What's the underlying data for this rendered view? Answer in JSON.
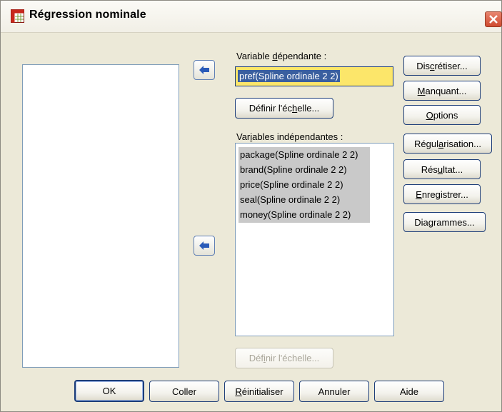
{
  "window": {
    "title": "Régression nominale"
  },
  "dependent": {
    "label_pre": "Variable ",
    "label_accel": "d",
    "label_post": "épendante :",
    "value": "pref(Spline ordinale 2 2)",
    "define_scale": {
      "pre": "Définir l'éc",
      "accel": "h",
      "post": "elle..."
    }
  },
  "independent": {
    "label_pre": "Var",
    "label_accel": "i",
    "label_post": "ables indépendantes :",
    "items": [
      "package(Spline ordinale 2 2)",
      "brand(Spline ordinale 2 2)",
      "price(Spline ordinale 2 2)",
      "seal(Spline ordinale 2 2)",
      "money(Spline ordinale 2 2)"
    ],
    "define_scale": {
      "pre": "Déf",
      "accel": "i",
      "post": "nir l'échelle..."
    }
  },
  "side_buttons": {
    "discretiser": {
      "pre": "Dis",
      "accel": "c",
      "post": "rétiser..."
    },
    "manquant": {
      "pre": "",
      "accel": "M",
      "post": "anquant..."
    },
    "options": {
      "pre": "",
      "accel": "O",
      "post": "ptions"
    },
    "regularisation": {
      "pre": "Régul",
      "accel": "a",
      "post": "risation..."
    },
    "resultat": {
      "pre": "Rés",
      "accel": "u",
      "post": "ltat..."
    },
    "enregistrer": {
      "pre": "",
      "accel": "E",
      "post": "nregistrer..."
    },
    "diagrammes": {
      "pre": "Diagrammes...",
      "accel": "",
      "post": ""
    }
  },
  "bottom_buttons": {
    "ok": "OK",
    "coller": {
      "pre": "Coller",
      "accel": "",
      "post": ""
    },
    "reinitialiser": {
      "pre": "",
      "accel": "R",
      "post": "éinitialiser"
    },
    "annuler": "Annuler",
    "aide": "Aide"
  }
}
